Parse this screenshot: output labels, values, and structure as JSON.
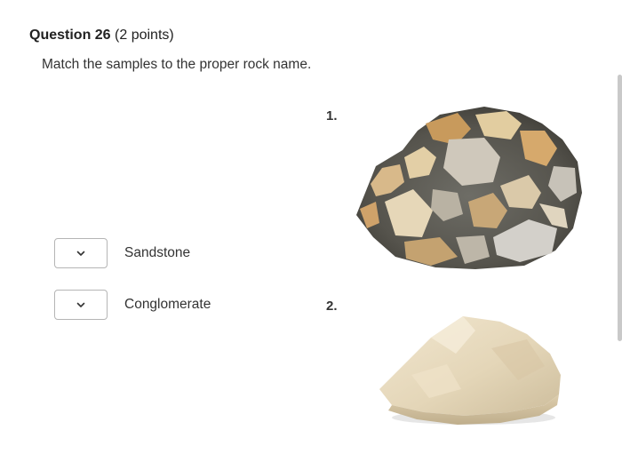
{
  "question": {
    "title": "Question 26",
    "points": "(2 points)",
    "prompt": "Match the samples to the proper rock name."
  },
  "matches": [
    {
      "label": "Sandstone",
      "selected": ""
    },
    {
      "label": "Conglomerate",
      "selected": ""
    }
  ],
  "samples": [
    {
      "number": "1.",
      "image": "breccia-rock-image"
    },
    {
      "number": "2.",
      "image": "sandstone-rock-image"
    }
  ],
  "icons": {
    "dropdown": "chevron-down-icon"
  }
}
